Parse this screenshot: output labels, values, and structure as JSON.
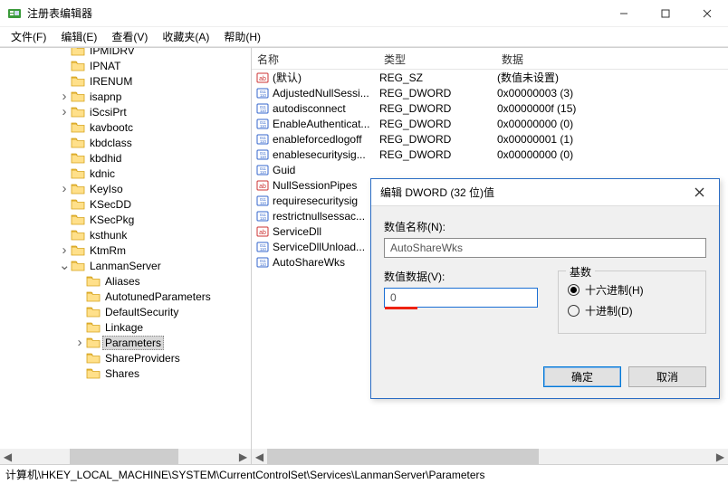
{
  "window": {
    "title": "注册表编辑器"
  },
  "menu": {
    "file": "文件(F)",
    "edit": "编辑(E)",
    "view": "查看(V)",
    "favorites": "收藏夹(A)",
    "help": "帮助(H)"
  },
  "tree": {
    "items": [
      {
        "indent": 5,
        "exp": "",
        "label": "IPMIDRV"
      },
      {
        "indent": 5,
        "exp": "",
        "label": "IPNAT"
      },
      {
        "indent": 5,
        "exp": "",
        "label": "IRENUM"
      },
      {
        "indent": 5,
        "exp": ">",
        "label": "isapnp"
      },
      {
        "indent": 5,
        "exp": ">",
        "label": "iScsiPrt"
      },
      {
        "indent": 5,
        "exp": "",
        "label": "kavbootc"
      },
      {
        "indent": 5,
        "exp": "",
        "label": "kbdclass"
      },
      {
        "indent": 5,
        "exp": "",
        "label": "kbdhid"
      },
      {
        "indent": 5,
        "exp": "",
        "label": "kdnic"
      },
      {
        "indent": 5,
        "exp": ">",
        "label": "KeyIso"
      },
      {
        "indent": 5,
        "exp": "",
        "label": "KSecDD"
      },
      {
        "indent": 5,
        "exp": "",
        "label": "KSecPkg"
      },
      {
        "indent": 5,
        "exp": "",
        "label": "ksthunk"
      },
      {
        "indent": 5,
        "exp": ">",
        "label": "KtmRm"
      },
      {
        "indent": 5,
        "exp": "v",
        "label": "LanmanServer"
      },
      {
        "indent": 6,
        "exp": "",
        "label": "Aliases"
      },
      {
        "indent": 6,
        "exp": "",
        "label": "AutotunedParameters"
      },
      {
        "indent": 6,
        "exp": "",
        "label": "DefaultSecurity"
      },
      {
        "indent": 6,
        "exp": "",
        "label": "Linkage"
      },
      {
        "indent": 6,
        "exp": ">",
        "label": "Parameters",
        "selected": true
      },
      {
        "indent": 6,
        "exp": "",
        "label": "ShareProviders"
      },
      {
        "indent": 6,
        "exp": "",
        "label": "Shares"
      }
    ]
  },
  "list": {
    "cols": {
      "name": "名称",
      "type": "类型",
      "data": "数据"
    },
    "rows": [
      {
        "icon": "sz",
        "name": "(默认)",
        "type": "REG_SZ",
        "data": "(数值未设置)"
      },
      {
        "icon": "dw",
        "name": "AdjustedNullSessi...",
        "type": "REG_DWORD",
        "data": "0x00000003 (3)"
      },
      {
        "icon": "dw",
        "name": "autodisconnect",
        "type": "REG_DWORD",
        "data": "0x0000000f (15)"
      },
      {
        "icon": "dw",
        "name": "EnableAuthenticat...",
        "type": "REG_DWORD",
        "data": "0x00000000 (0)"
      },
      {
        "icon": "dw",
        "name": "enableforcedlogoff",
        "type": "REG_DWORD",
        "data": "0x00000001 (1)"
      },
      {
        "icon": "dw",
        "name": "enablesecuritysig...",
        "type": "REG_DWORD",
        "data": "0x00000000 (0)"
      },
      {
        "icon": "dw",
        "name": "Guid",
        "type": "",
        "data": ""
      },
      {
        "icon": "sz",
        "name": "NullSessionPipes",
        "type": "",
        "data": ""
      },
      {
        "icon": "dw",
        "name": "requiresecuritysig",
        "type": "",
        "data": ""
      },
      {
        "icon": "dw",
        "name": "restrictnullsessac...",
        "type": "",
        "data": ""
      },
      {
        "icon": "sz",
        "name": "ServiceDll",
        "type": "",
        "data": ""
      },
      {
        "icon": "dw",
        "name": "ServiceDllUnload...",
        "type": "",
        "data": ""
      },
      {
        "icon": "dw",
        "name": "AutoShareWks",
        "type": "",
        "data": ""
      }
    ],
    "overflow_num": "64"
  },
  "dialog": {
    "title": "编辑 DWORD (32 位)值",
    "name_label": "数值名称(N):",
    "name_value": "AutoShareWks",
    "data_label": "数值数据(V):",
    "data_value": "0",
    "base_label": "基数",
    "radix_hex": "十六进制(H)",
    "radix_dec": "十进制(D)",
    "ok": "确定",
    "cancel": "取消"
  },
  "status": {
    "path": "计算机\\HKEY_LOCAL_MACHINE\\SYSTEM\\CurrentControlSet\\Services\\LanmanServer\\Parameters"
  }
}
